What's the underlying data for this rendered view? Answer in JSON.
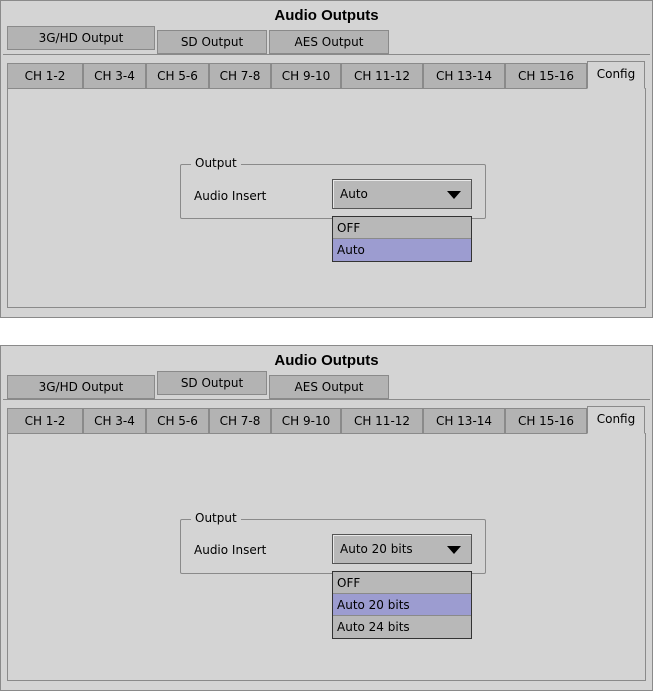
{
  "panels": [
    {
      "title": "Audio Outputs",
      "output_tabs": [
        "3G/HD Output",
        "SD Output",
        "AES Output"
      ],
      "active_output_tab": 0,
      "channel_tabs": [
        "CH 1-2",
        "CH 3-4",
        "CH 5-6",
        "CH 7-8",
        "CH 9-10",
        "CH 11-12",
        "CH 13-14",
        "CH 15-16",
        "Config"
      ],
      "active_channel_tab": 8,
      "group_legend": "Output",
      "field_label": "Audio Insert",
      "combo_value": "Auto",
      "dropdown_options": [
        "OFF",
        "Auto"
      ],
      "dropdown_selected": 1
    },
    {
      "title": "Audio Outputs",
      "output_tabs": [
        "3G/HD Output",
        "SD Output",
        "AES Output"
      ],
      "active_output_tab": 1,
      "channel_tabs": [
        "CH 1-2",
        "CH 3-4",
        "CH 5-6",
        "CH 7-8",
        "CH 9-10",
        "CH 11-12",
        "CH 13-14",
        "CH 15-16",
        "Config"
      ],
      "active_channel_tab": 8,
      "group_legend": "Output",
      "field_label": "Audio Insert",
      "combo_value": "Auto 20 bits",
      "dropdown_options": [
        "OFF",
        "Auto 20 bits",
        "Auto 24 bits"
      ],
      "dropdown_selected": 1
    }
  ],
  "colors": {
    "panel_bg": "#d4d4d4",
    "tab_inactive": "#b3b3b3",
    "selection": "#9c9cd0"
  }
}
